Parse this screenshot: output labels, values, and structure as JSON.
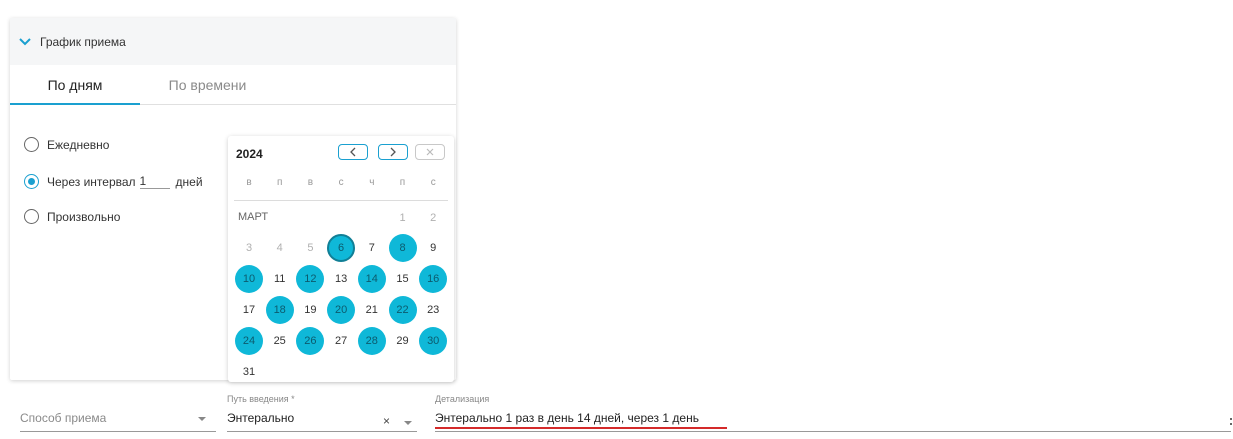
{
  "section": {
    "title": "График приема"
  },
  "tabs": [
    {
      "label": "По дням",
      "active": true
    },
    {
      "label": "По времени",
      "active": false
    }
  ],
  "frequency": {
    "daily_label": "Ежедневно",
    "interval_label": "Через интервал",
    "interval_value": "1",
    "interval_unit": "дней",
    "custom_label": "Произвольно",
    "selected": "interval"
  },
  "calendar": {
    "year": "2024",
    "weekdays": [
      "в",
      "п",
      "в",
      "с",
      "ч",
      "п",
      "с"
    ],
    "month": "МАРТ",
    "prev_days": [
      "1",
      "2"
    ],
    "weeks": [
      [
        "3",
        "4",
        "5",
        "6",
        "7",
        "8",
        "9"
      ],
      [
        "10",
        "11",
        "12",
        "13",
        "14",
        "15",
        "16"
      ],
      [
        "17",
        "18",
        "19",
        "20",
        "21",
        "22",
        "23"
      ],
      [
        "24",
        "25",
        "26",
        "27",
        "28",
        "29",
        "30"
      ],
      [
        "31"
      ]
    ],
    "selected_days": [
      "6",
      "8",
      "10",
      "12",
      "14",
      "16",
      "18",
      "20",
      "22",
      "24",
      "26",
      "28",
      "30"
    ],
    "current_day": "6",
    "accent_color": "#0fb8d8"
  },
  "form": {
    "method": {
      "placeholder": "Способ приема"
    },
    "route": {
      "label": "Путь введения *",
      "value": "Энтерально"
    },
    "details": {
      "label": "Детализация",
      "value": "Энтерально 1 раз в день 14 дней, через  1 день"
    }
  }
}
